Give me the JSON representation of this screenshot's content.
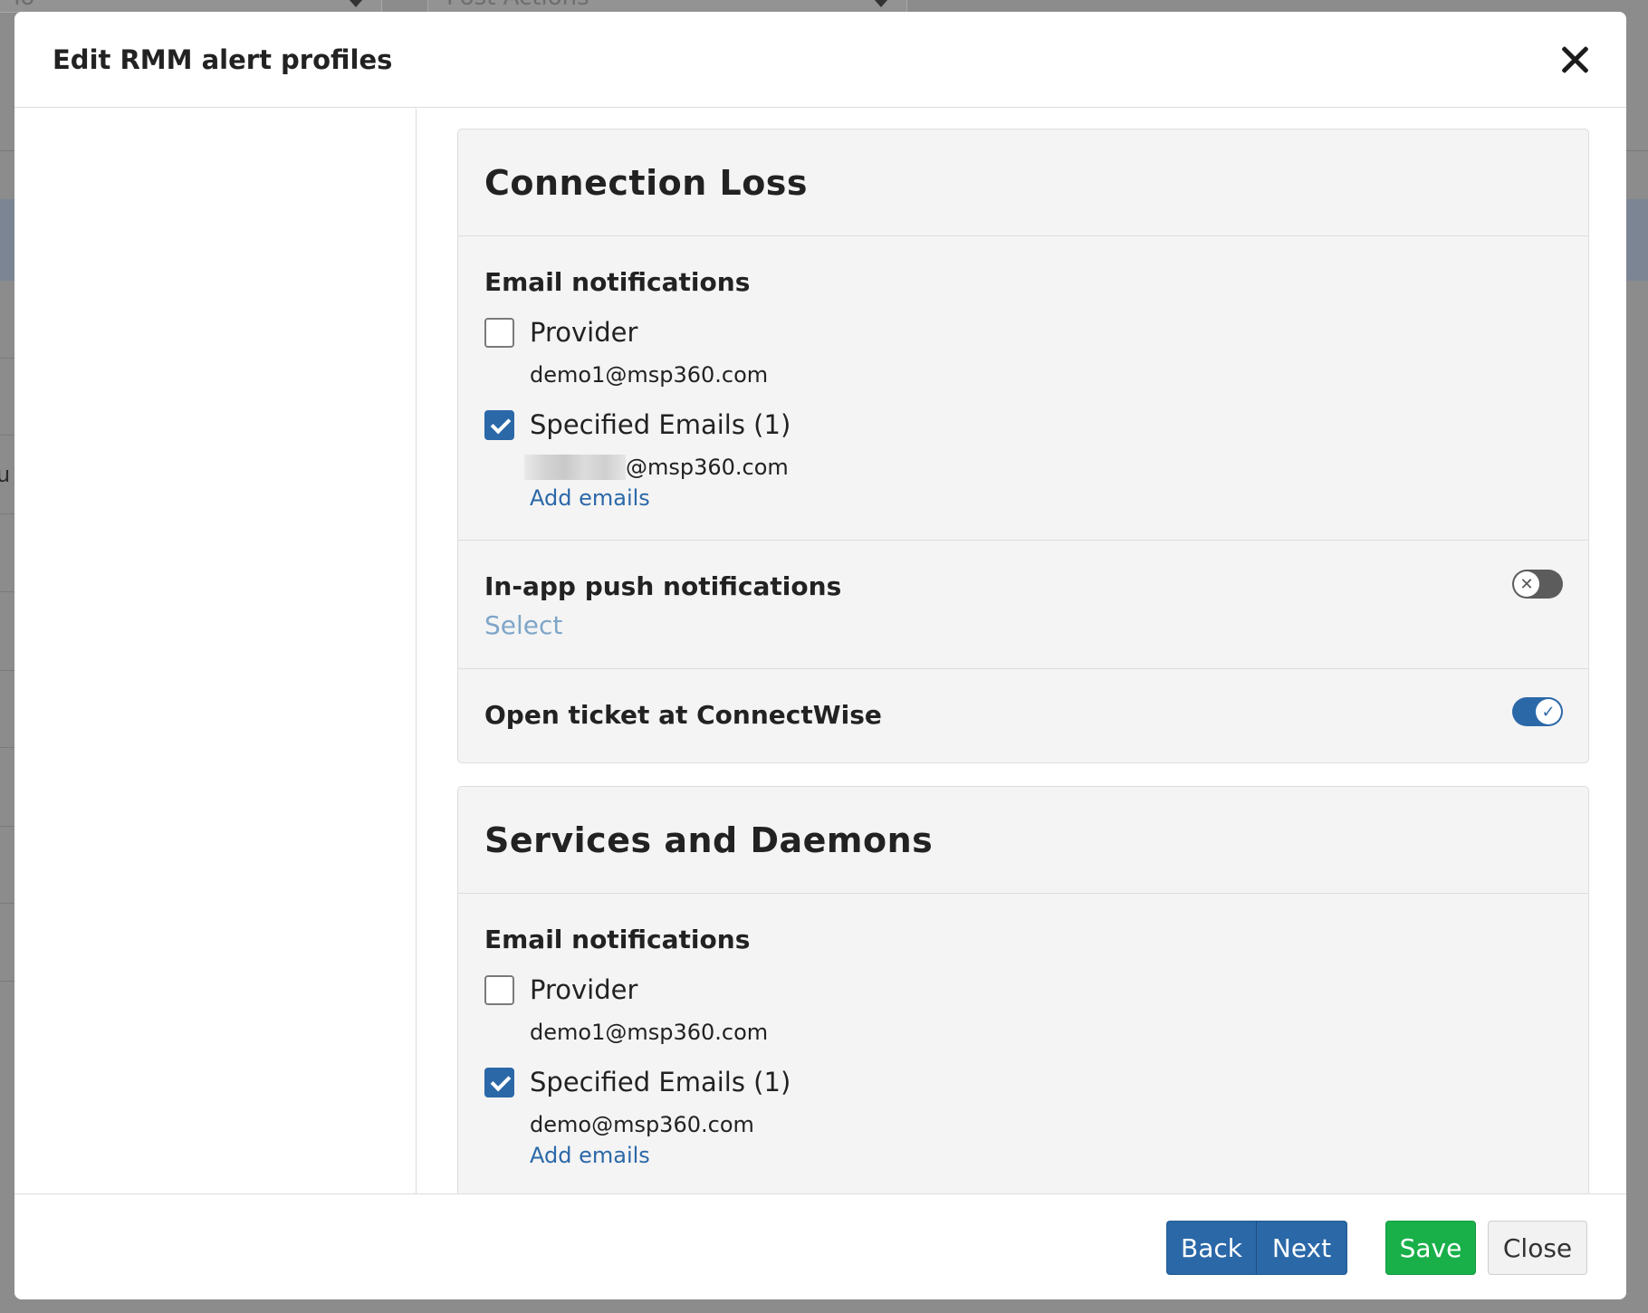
{
  "background": {
    "select_left_value": "To",
    "select_right_value": "Post Actions",
    "stray_char": "u"
  },
  "modal": {
    "title": "Edit RMM alert profiles"
  },
  "sections": [
    {
      "title": "Connection Loss",
      "email_label": "Email notifications",
      "provider_label": "Provider",
      "provider_checked": false,
      "provider_email": "demo1@msp360.com",
      "specified_label": "Specified Emails (1)",
      "specified_checked": true,
      "specified_email_domain": "@msp360.com",
      "add_emails": "Add emails",
      "push_label": "In-app push notifications",
      "push_select": "Select",
      "push_enabled": false,
      "ticket_label": "Open ticket at ConnectWise",
      "ticket_enabled": true
    },
    {
      "title": "Services and Daemons",
      "email_label": "Email notifications",
      "provider_label": "Provider",
      "provider_checked": false,
      "provider_email": "demo1@msp360.com",
      "specified_label": "Specified Emails (1)",
      "specified_checked": true,
      "specified_email": "demo@msp360.com",
      "add_emails": "Add emails"
    }
  ],
  "footer": {
    "back_label": "Back",
    "next_label": "Next",
    "save_label": "Save",
    "close_label": "Close"
  },
  "colors": {
    "primary": "#2b68a8",
    "save": "#19b04a",
    "link_muted": "#7fa6c9"
  }
}
